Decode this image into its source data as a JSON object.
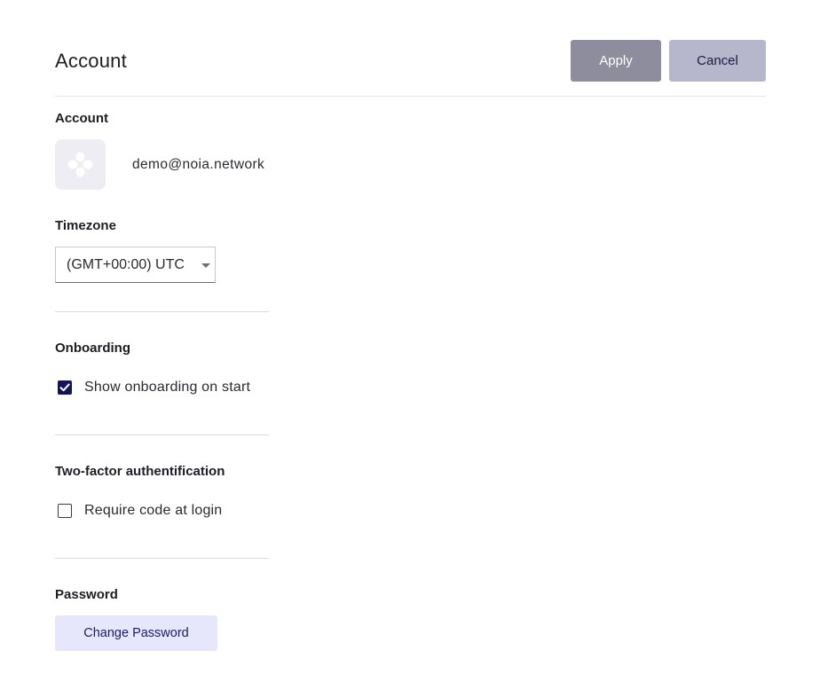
{
  "header": {
    "title": "Account",
    "apply_label": "Apply",
    "cancel_label": "Cancel"
  },
  "account": {
    "section_title": "Account",
    "avatar_icon": "noia-logo-icon",
    "email": "demo@noia.network"
  },
  "timezone": {
    "section_title": "Timezone",
    "selected": "(GMT+00:00) UTC",
    "caret_icon": "caret-down-icon"
  },
  "onboarding": {
    "section_title": "Onboarding",
    "option_label": "Show onboarding on start",
    "checked": true
  },
  "two_factor": {
    "section_title": "Two-factor authentification",
    "option_label": "Require code at login",
    "checked": false
  },
  "password": {
    "section_title": "Password",
    "button_label": "Change Password"
  },
  "colors": {
    "apply_bg": "#8e8d9d",
    "cancel_bg": "#b6b6cd",
    "checkbox_checked": "#14145a",
    "change_password_bg": "#e6e7fb"
  }
}
